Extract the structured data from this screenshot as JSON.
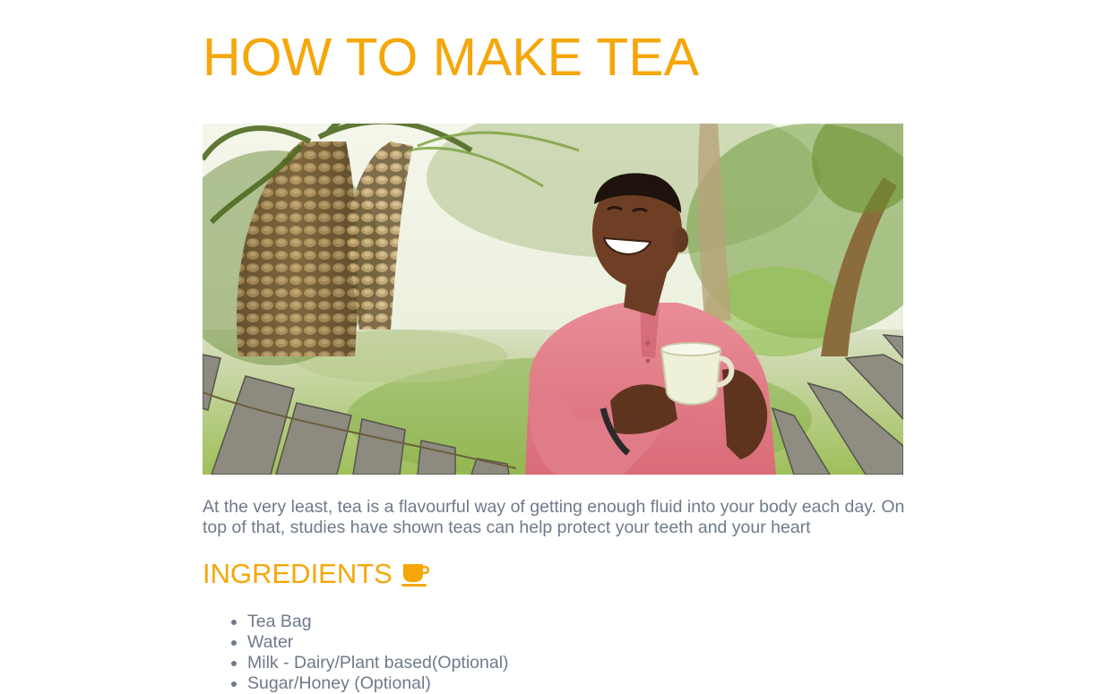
{
  "page": {
    "title": "HOW TO MAKE TEA",
    "hero_image_alt": "Man laughing holding a cup of tea outdoors",
    "intro": "At the very least, tea is a flavourful way of getting enough fluid into your body each day. On top of that, studies have shown teas can help protect your teeth and your heart"
  },
  "ingredients": {
    "heading": "INGREDIENTS",
    "icon": "coffee-cup-icon",
    "items": [
      "Tea Bag",
      "Water",
      "Milk - Dairy/Plant based(Optional)",
      "Sugar/Honey (Optional)"
    ]
  },
  "colors": {
    "accent": "#f5a70a",
    "body_text": "#6f7a8a",
    "background": "#ffffff"
  }
}
